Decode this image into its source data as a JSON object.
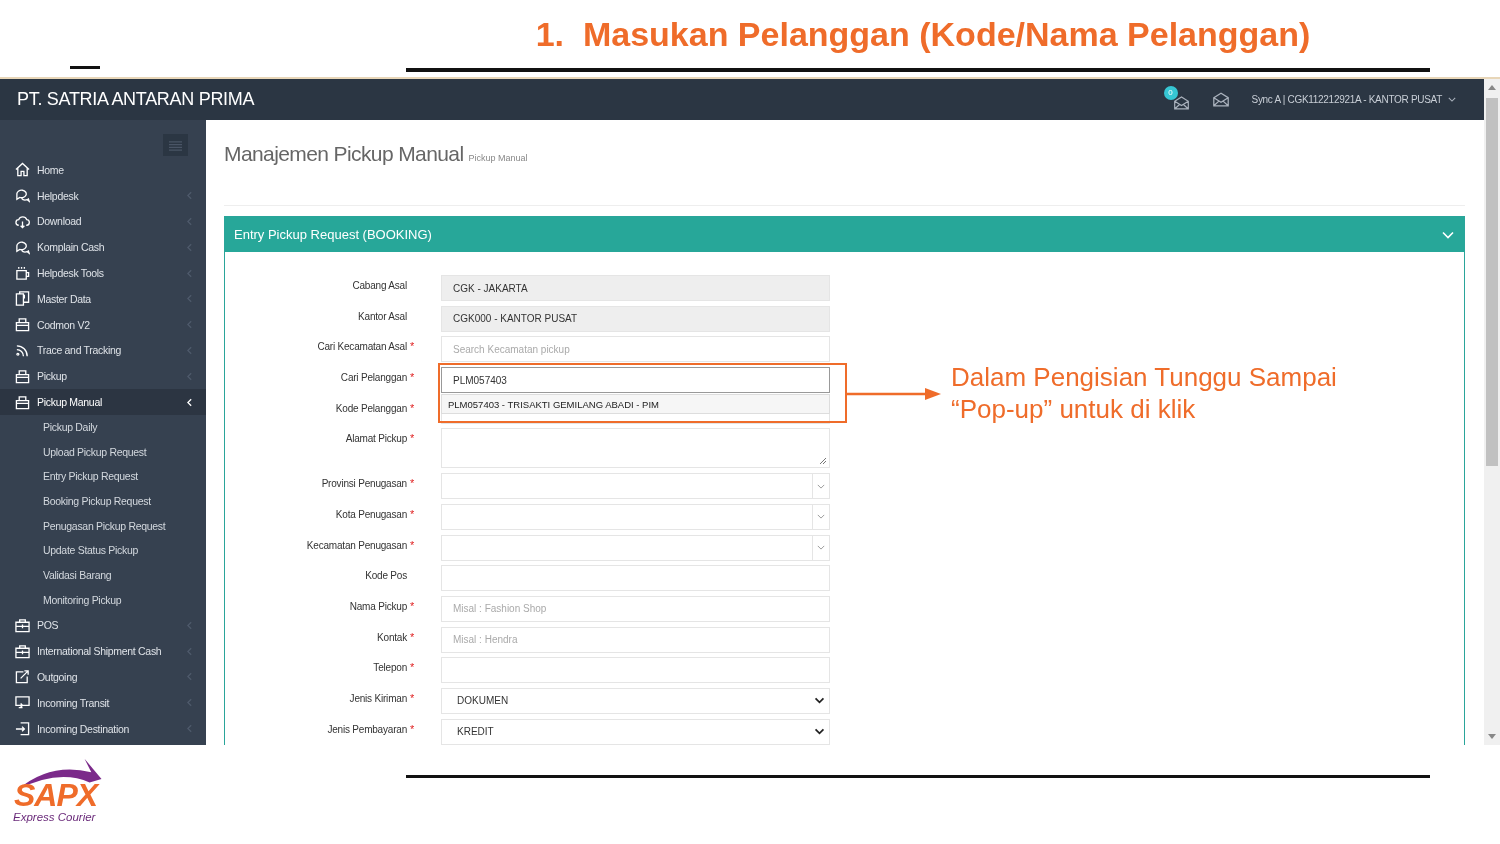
{
  "slide": {
    "number": "1.",
    "title": "Masukan Pelanggan (Kode/Nama Pelanggan)"
  },
  "app": {
    "brand": "PT. SATRIA ANTARAN PRIMA",
    "notification_count": "0",
    "user": "Sync A | CGK112212921A - KANTOR PUSAT"
  },
  "sidebar": {
    "items": [
      {
        "label": "Home",
        "kind": "home",
        "has_submenu": false,
        "selected": false
      },
      {
        "label": "Helpdesk",
        "kind": "chat",
        "has_submenu": true,
        "selected": false
      },
      {
        "label": "Download",
        "kind": "cloud",
        "has_submenu": true,
        "selected": false
      },
      {
        "label": "Komplain Cash",
        "kind": "chat",
        "has_submenu": true,
        "selected": false
      },
      {
        "label": "Helpdesk Tools",
        "kind": "cup",
        "has_submenu": true,
        "selected": false
      },
      {
        "label": "Master Data",
        "kind": "doc",
        "has_submenu": true,
        "selected": false
      },
      {
        "label": "Codmon V2",
        "kind": "bag",
        "has_submenu": true,
        "selected": false
      },
      {
        "label": "Trace and Tracking",
        "kind": "rss",
        "has_submenu": true,
        "selected": false
      },
      {
        "label": "Pickup",
        "kind": "bag",
        "has_submenu": true,
        "selected": false
      },
      {
        "label": "Pickup Manual",
        "kind": "bag",
        "has_submenu": true,
        "selected": true,
        "children": [
          {
            "label": "Pickup Daily"
          },
          {
            "label": "Upload Pickup Request"
          },
          {
            "label": "Entry Pickup Request"
          },
          {
            "label": "Booking Pickup Request"
          },
          {
            "label": "Penugasan Pickup Request"
          },
          {
            "label": "Update Status Pickup"
          },
          {
            "label": "Validasi Barang"
          },
          {
            "label": "Monitoring Pickup"
          }
        ]
      },
      {
        "label": "POS",
        "kind": "briefcase",
        "has_submenu": true,
        "selected": false
      },
      {
        "label": "International Shipment Cash",
        "kind": "briefcase",
        "has_submenu": true,
        "selected": false
      },
      {
        "label": "Outgoing",
        "kind": "share",
        "has_submenu": true,
        "selected": false
      },
      {
        "label": "Incoming Transit",
        "kind": "monitor",
        "has_submenu": true,
        "selected": false
      },
      {
        "label": "Incoming Destination",
        "kind": "login",
        "has_submenu": true,
        "selected": false
      }
    ]
  },
  "page": {
    "title": "Manajemen Pickup Manual",
    "subtitle": "Pickup Manual"
  },
  "panel": {
    "title": "Entry Pickup Request (BOOKING)",
    "fields": [
      {
        "label": "Cabang Asal",
        "kind": "readonly",
        "value": "CGK - JAKARTA"
      },
      {
        "label": "Kantor Asal",
        "kind": "readonly",
        "value": "CGK000 - KANTOR PUSAT"
      },
      {
        "label": "Cari Kecamatan Asal",
        "required_mark": "*",
        "kind": "input",
        "placeholder": "Search Kecamatan pickup"
      },
      {
        "label": "Cari Pelanggan",
        "required_mark": "*",
        "kind": "input",
        "value": "PLM057403",
        "suggestion": "PLM057403 - TRISAKTI GEMILANG ABADI - PIM"
      },
      {
        "label": "Kode Pelanggan",
        "required_mark": "*",
        "kind": "input"
      },
      {
        "label": "Alamat Pickup",
        "required_mark": "*",
        "kind": "textarea"
      },
      {
        "label": "Provinsi Penugasan",
        "required_mark": "*",
        "kind": "combo"
      },
      {
        "label": "Kota Penugasan",
        "required_mark": "*",
        "kind": "combo"
      },
      {
        "label": "Kecamatan Penugasan",
        "required_mark": "*",
        "kind": "combo"
      },
      {
        "label": "Kode Pos",
        "kind": "input"
      },
      {
        "label": "Nama Pickup",
        "required_mark": "*",
        "kind": "input",
        "placeholder": "Misal : Fashion Shop"
      },
      {
        "label": "Kontak",
        "required_mark": "*",
        "kind": "input",
        "placeholder": "Misal : Hendra"
      },
      {
        "label": "Telepon",
        "required_mark": "*",
        "kind": "input"
      },
      {
        "label": "Jenis Kiriman",
        "required_mark": "*",
        "kind": "select",
        "value": "DOKUMEN"
      },
      {
        "label": "Jenis Pembayaran",
        "required_mark": "*",
        "kind": "select",
        "value": "KREDIT"
      }
    ]
  },
  "annotation": {
    "text": "Dalam Pengisian Tunggu Sampai “Pop-up” untuk di klik"
  },
  "logo": {
    "name": "SAPX",
    "tagline": "Express Courier"
  }
}
